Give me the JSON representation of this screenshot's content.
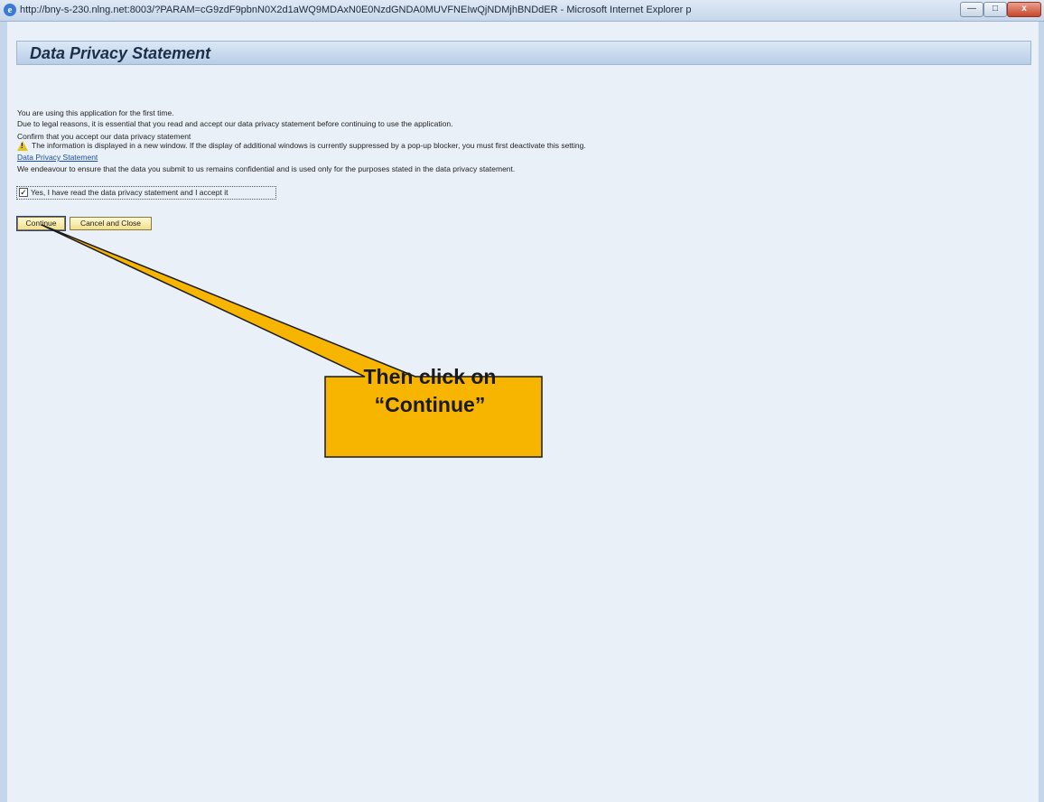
{
  "window": {
    "title": "http://bny-s-230.nlng.net:8003/?PARAM=cG9zdF9pbnN0X2d1aWQ9MDAxN0E0NzdGNDA0MUVFNEIwQjNDMjhBNDdER - Microsoft Internet Explorer p",
    "min_glyph": "—",
    "max_glyph": "□",
    "close_glyph": "x"
  },
  "page": {
    "title": "Data Privacy Statement",
    "line1": "You are using this application for the first time.",
    "line2": "Due to legal reasons, it is essential that you read and accept our data privacy statement before continuing to use the application.",
    "confirm_heading": "Confirm that you accept our data privacy statement",
    "warning_text": "The information is displayed in a new window. If the display of additional windows is currently suppressed by a pop-up blocker, you must first deactivate this setting.",
    "privacy_link": "Data Privacy Statement",
    "confidential_text": "We endeavour to ensure that the data you submit to us remains confidential and is used only for the purposes stated in the data privacy statement.",
    "checkbox_label": "Yes, I have read the data privacy statement and I accept it",
    "checkbox_checked": true
  },
  "buttons": {
    "continue": "Continue",
    "cancel_close": "Cancel and Close"
  },
  "callout": {
    "line1": "Then click on",
    "line2": "“Continue”",
    "fill_color": "#f7b500"
  },
  "icons": {
    "browser": "ie-icon",
    "warning": "warning-icon"
  }
}
